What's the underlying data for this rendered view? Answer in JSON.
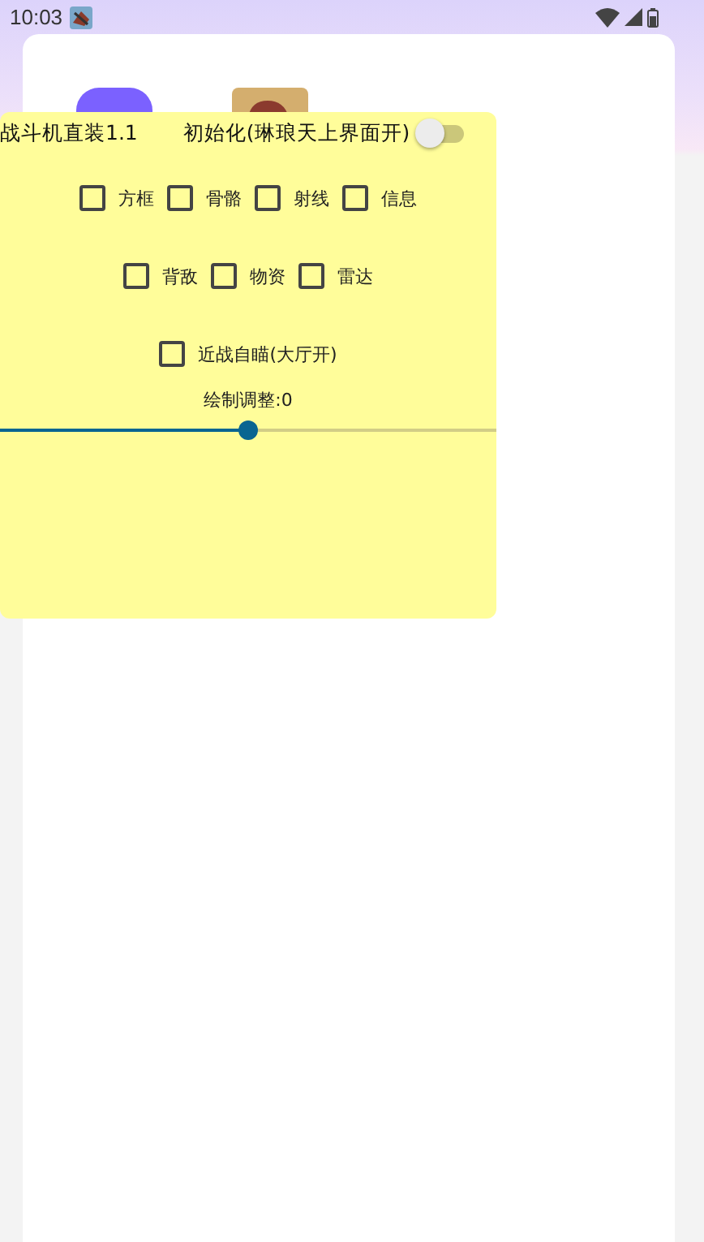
{
  "status_bar": {
    "time": "10:03"
  },
  "panel": {
    "title": "战斗机直装1.1",
    "toggle": {
      "label": "初始化(琳琅天上界面开)",
      "on": false
    },
    "checkbox_rows": [
      {
        "items": [
          {
            "label": "方框",
            "checked": false
          },
          {
            "label": "骨骼",
            "checked": false
          },
          {
            "label": "射线",
            "checked": false
          },
          {
            "label": "信息",
            "checked": false
          }
        ]
      },
      {
        "items": [
          {
            "label": "背敌",
            "checked": false
          },
          {
            "label": "物资",
            "checked": false
          },
          {
            "label": "雷达",
            "checked": false
          }
        ]
      },
      {
        "items": [
          {
            "label": "近战自瞄(大厅开)",
            "checked": false
          }
        ]
      }
    ],
    "slider": {
      "label": "绘制调整:0",
      "level": 0.5
    }
  }
}
